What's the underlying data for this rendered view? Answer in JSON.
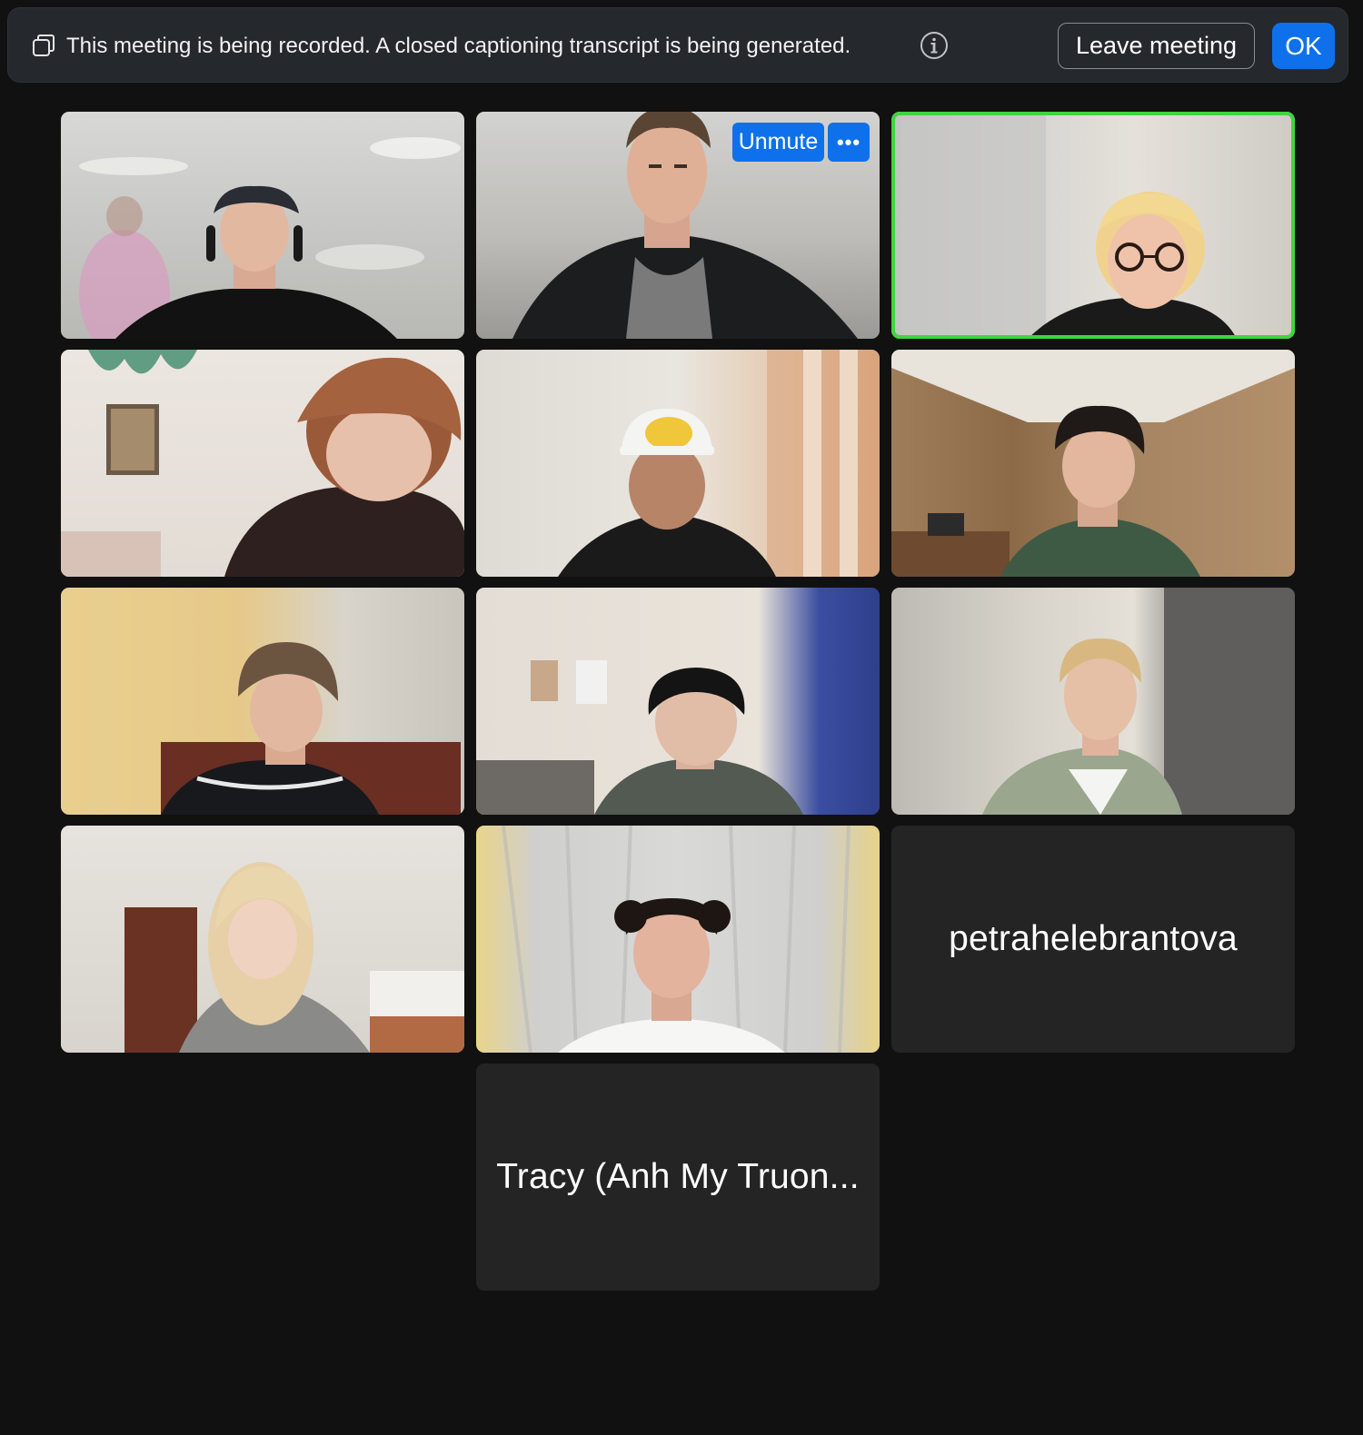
{
  "notice": {
    "text": "This meeting is being recorded. A closed captioning transcript is being generated.",
    "leave_label": "Leave meeting",
    "ok_label": "OK"
  },
  "tiles": [
    {
      "kind": "video",
      "description_icon": "participant-video"
    },
    {
      "kind": "video",
      "unmute_label": "Unmute",
      "more_label": "•••"
    },
    {
      "kind": "video",
      "active_speaker": true
    },
    {
      "kind": "video"
    },
    {
      "kind": "video"
    },
    {
      "kind": "video"
    },
    {
      "kind": "video"
    },
    {
      "kind": "video"
    },
    {
      "kind": "video"
    },
    {
      "kind": "video"
    },
    {
      "kind": "video"
    },
    {
      "kind": "name",
      "name": "petrahelebrantova"
    },
    {
      "kind": "name",
      "name": "Tracy (Anh My Truon..."
    }
  ],
  "colors": {
    "accent": "#0e71eb",
    "active_speaker_border": "#3fd53f",
    "background": "#111111",
    "tile_background": "#242424"
  }
}
